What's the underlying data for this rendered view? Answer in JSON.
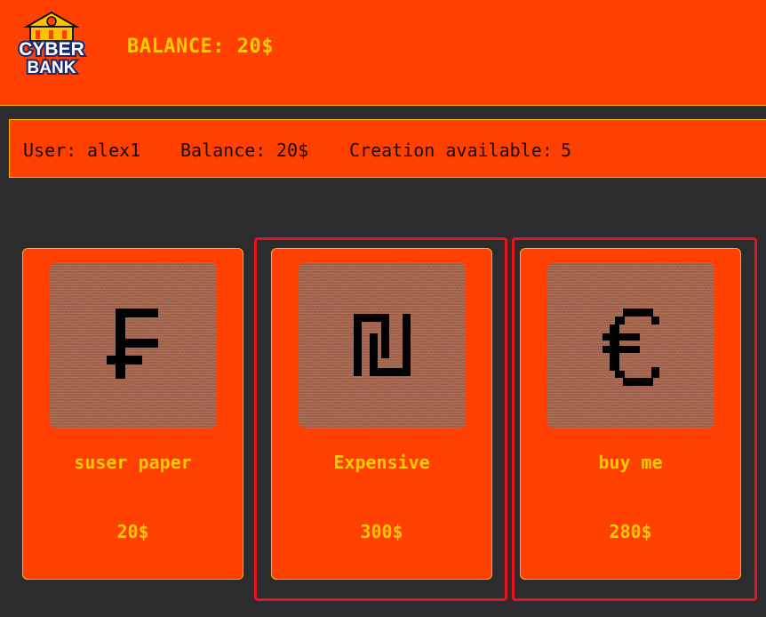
{
  "header": {
    "logo": {
      "line1": "CYBER",
      "line2": "BANK",
      "icon": "bank-coin-icon"
    },
    "balance_label": "BALANCE:",
    "balance_value": "20$"
  },
  "info": {
    "user_label": "User:",
    "user_value": "alex1",
    "balance_label": "Balance:",
    "balance_value": "20$",
    "creation_label": "Creation available:",
    "creation_value": "5"
  },
  "cards": [
    {
      "name": "suser paper",
      "price": "20$",
      "icon": "franc-sign-icon",
      "selected": false
    },
    {
      "name": "Expensive",
      "price": "300$",
      "icon": "shekel-sign-icon",
      "selected": true
    },
    {
      "name": "buy me",
      "price": "280$",
      "icon": "euro-sign-icon",
      "selected": true
    }
  ],
  "colors": {
    "primary": "#ff4000",
    "accent": "#ffcc00",
    "background": "#2c2c2e",
    "selection": "#e8141c"
  }
}
